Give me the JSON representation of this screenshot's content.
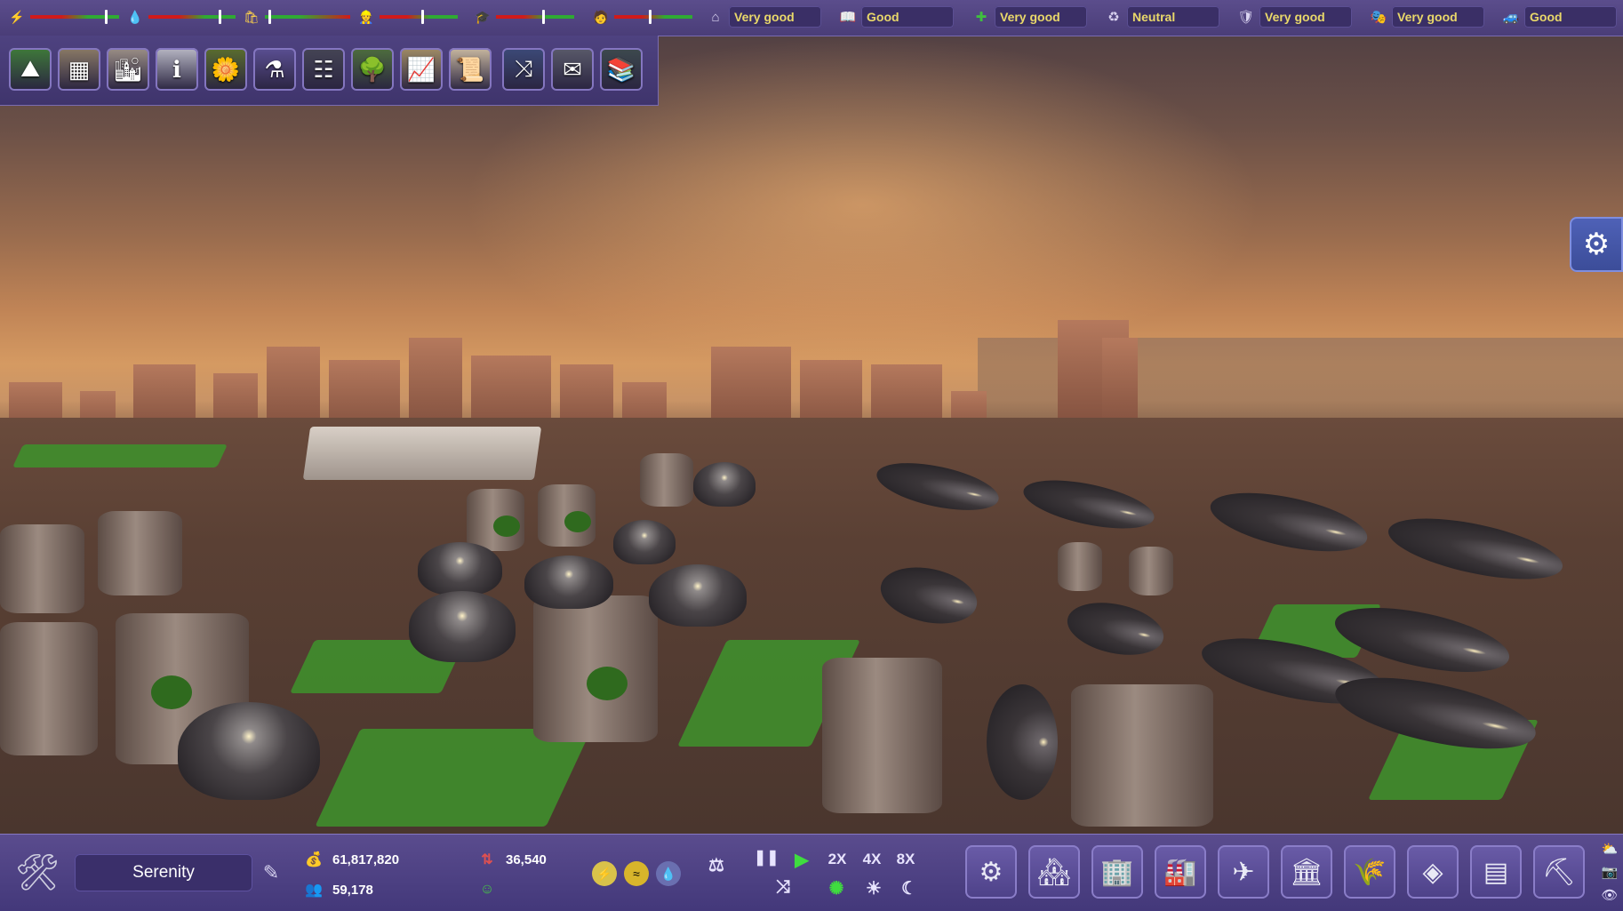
{
  "top_bar": {
    "meters": [
      {
        "name": "electricity",
        "icon": "lightning-icon",
        "glyph": "⚡",
        "level": 0.85
      },
      {
        "name": "water",
        "icon": "water-drop-icon",
        "glyph": "💧",
        "level": 0.82
      },
      {
        "name": "waste",
        "icon": "garbage-bag-icon",
        "glyph": "🛍",
        "level": 0.05
      },
      {
        "name": "workers",
        "icon": "worker-helmet-icon",
        "glyph": "👷",
        "level": 0.55
      },
      {
        "name": "education",
        "icon": "student-icon",
        "glyph": "🎓",
        "level": 0.6
      },
      {
        "name": "specialists",
        "icon": "specialist-icon",
        "glyph": "🧑",
        "level": 0.45
      }
    ],
    "ratings": [
      {
        "name": "housing",
        "icon": "house-icon",
        "glyph": "⌂",
        "value": "Very good"
      },
      {
        "name": "culture",
        "icon": "book-icon",
        "glyph": "📖",
        "value": "Good"
      },
      {
        "name": "health",
        "icon": "medical-cross-icon",
        "glyph": "✚",
        "value": "Very good"
      },
      {
        "name": "environment",
        "icon": "recycle-icon",
        "glyph": "♻",
        "value": "Neutral"
      },
      {
        "name": "safety",
        "icon": "shield-icon",
        "glyph": "🛡",
        "value": "Very good"
      },
      {
        "name": "entertainment",
        "icon": "theater-masks-icon",
        "glyph": "🎭",
        "value": "Very good"
      },
      {
        "name": "transport",
        "icon": "vehicle-icon",
        "glyph": "🚙",
        "value": "Good"
      }
    ]
  },
  "build_toolbar": {
    "buttons": [
      {
        "icon": "terrain-icon",
        "glyph": "⛰",
        "color": "#3f7a3a"
      },
      {
        "icon": "blocks-icon",
        "glyph": "▦",
        "color": "#8a7a66"
      },
      {
        "icon": "city-buildings-icon",
        "glyph": "🏙",
        "color": "#9b8f86"
      },
      {
        "icon": "info-sign-icon",
        "glyph": "ℹ",
        "color": "#b7b7c4"
      },
      {
        "icon": "parks-icon",
        "glyph": "🌼",
        "color": "#5b6e2e"
      },
      {
        "icon": "laboratory-flask-icon",
        "glyph": "⚗",
        "color": "#5b4f93"
      },
      {
        "icon": "conveyor-icon",
        "glyph": "☷",
        "color": "#454555"
      },
      {
        "icon": "money-tree-icon",
        "glyph": "🌳",
        "color": "#4e6e3e"
      },
      {
        "icon": "statistics-graph-icon",
        "glyph": "📈",
        "color": "#a08c66"
      },
      {
        "icon": "document-scroll-icon",
        "glyph": "📜",
        "color": "#c8b8a0"
      },
      {
        "icon": "route-lines-icon",
        "glyph": "⤨",
        "color": "#3c4a78"
      },
      {
        "icon": "envelope-icon",
        "glyph": "✉",
        "color": "#5a5a6a"
      },
      {
        "icon": "library-books-icon",
        "glyph": "📚",
        "color": "#3d4a4e"
      }
    ]
  },
  "settings": {
    "icon": "gear-icon",
    "glyph": "⚙"
  },
  "bottom_bar": {
    "city_name": "Serenity",
    "money": "61,817,820",
    "population": "59,178",
    "income": "36,540",
    "glyphs": {
      "tools": "🛠",
      "edit": "✎",
      "money": "💰",
      "population": "👥",
      "income": "⇅",
      "happiness": "☺",
      "balance": "⚖",
      "pause": "❚❚",
      "play": "▶",
      "shuffle": "⤨",
      "auto": "✺",
      "day": "☀",
      "night": "☾"
    },
    "resources": [
      {
        "icon": "energy-resource-icon",
        "glyph": "⚡",
        "color": "#d9c24a"
      },
      {
        "icon": "food-resource-icon",
        "glyph": "≈",
        "color": "#d8b52b"
      },
      {
        "icon": "water-resource-icon",
        "glyph": "💧",
        "color": "#5a5f9e"
      }
    ],
    "speeds": [
      "2X",
      "4X",
      "8X"
    ],
    "categories": [
      {
        "icon": "energy-plant-icon",
        "glyph": "⚙"
      },
      {
        "icon": "residential-icon",
        "glyph": "🏘"
      },
      {
        "icon": "commercial-icon",
        "glyph": "🏢"
      },
      {
        "icon": "industry-icon",
        "glyph": "🏭"
      },
      {
        "icon": "transport-icon",
        "glyph": "✈"
      },
      {
        "icon": "civic-dome-icon",
        "glyph": "🏛"
      },
      {
        "icon": "farming-icon",
        "glyph": "🌾"
      },
      {
        "icon": "greenhouse-icon",
        "glyph": "◈"
      },
      {
        "icon": "storage-icon",
        "glyph": "▤"
      },
      {
        "icon": "bulldoze-icon",
        "glyph": "⛏"
      }
    ],
    "mini_buttons": [
      {
        "icon": "weather-icon",
        "glyph": "⛅"
      },
      {
        "icon": "camera-icon",
        "glyph": "📷"
      },
      {
        "icon": "eye-icon",
        "glyph": "👁"
      }
    ]
  }
}
